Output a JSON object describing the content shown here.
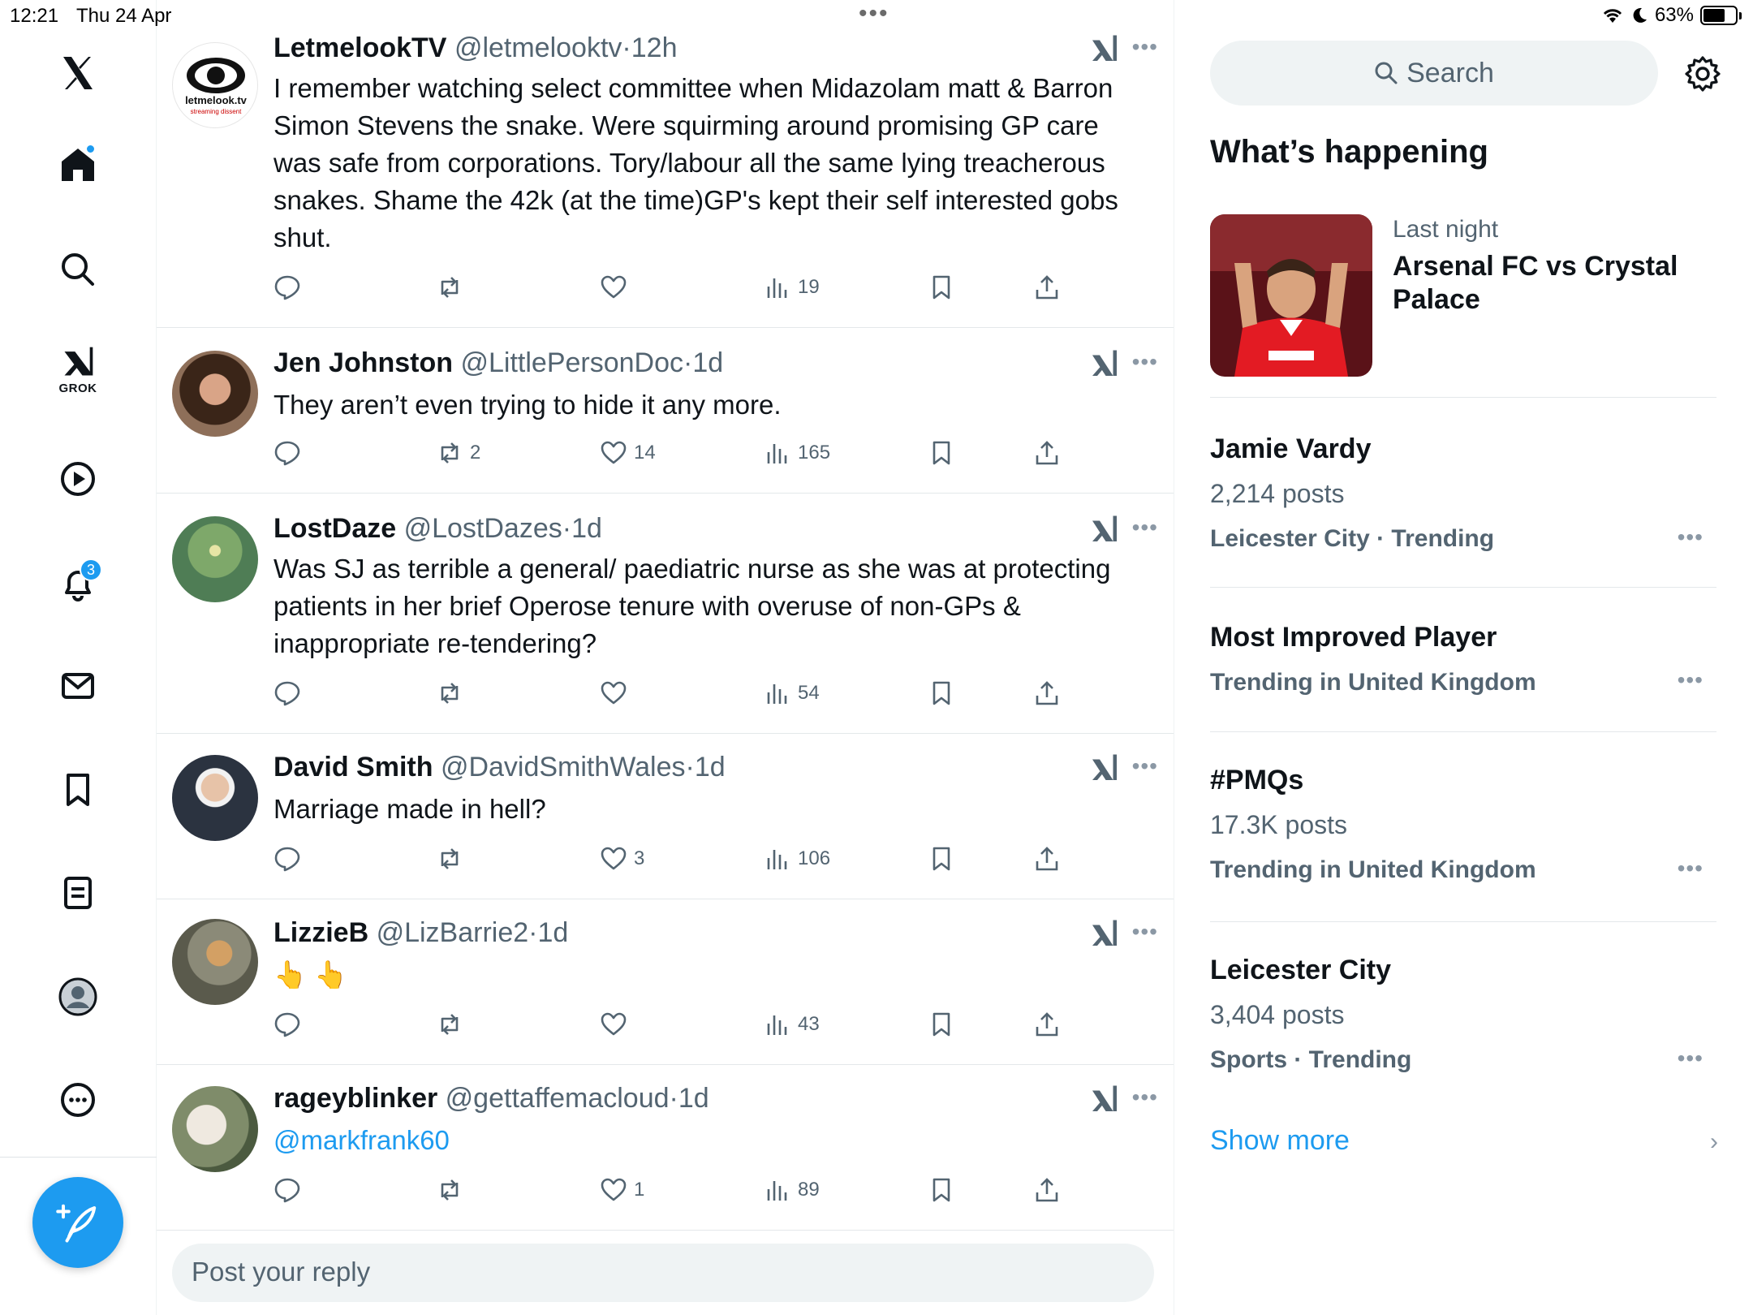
{
  "status_bar": {
    "time": "12:21",
    "date": "Thu 24 Apr",
    "battery": "63%",
    "dots": "•••"
  },
  "nav": {
    "grok_label": "GROK",
    "notifications_badge": "3",
    "accent": "#1d9bf0"
  },
  "tweets": [
    {
      "name": "LetmelookTV",
      "handle": "@letmelooktv",
      "time": "12h",
      "text": "I remember watching select committee when Midazolam matt & Barron Simon Stevens  the snake. Were squirming around promising GP care was safe from corporations. Tory/labour all the same lying treacherous snakes. Shame the 42k (at the time)GP's kept their self interested gobs shut.",
      "replies": "",
      "reposts": "",
      "likes": "",
      "views": "19",
      "avatar_text": "letmelook.tv",
      "avatar_sub": "streaming dissent"
    },
    {
      "name": "Jen Johnston",
      "handle": "@LittlePersonDoc",
      "time": "1d",
      "text": "They aren’t even trying to hide it any more.",
      "replies": "",
      "reposts": "2",
      "likes": "14",
      "views": "165"
    },
    {
      "name": "LostDaze",
      "handle": "@LostDazes",
      "time": "1d",
      "text": "Was SJ as terrible a general/ paediatric nurse as she was at protecting patients in her brief Operose tenure with overuse of non-GPs & inappropriate re-tendering?",
      "replies": "",
      "reposts": "",
      "likes": "",
      "views": "54"
    },
    {
      "name": "David Smith",
      "handle": "@DavidSmithWales",
      "time": "1d",
      "text": "Marriage made in hell?",
      "replies": "",
      "reposts": "",
      "likes": "3",
      "views": "106"
    },
    {
      "name": "LizzieB",
      "handle": "@LizBarrie2",
      "time": "1d",
      "text": "👆 👆",
      "replies": "",
      "reposts": "",
      "likes": "",
      "views": "43"
    },
    {
      "name": "rageyblinker",
      "handle": "@gettaffemacloud",
      "time": "1d",
      "text": "@markfrank60",
      "replies": "",
      "reposts": "",
      "likes": "1",
      "views": "89"
    }
  ],
  "reply": {
    "placeholder": "Post your reply"
  },
  "sidebar": {
    "search_label": "Search",
    "whats_happening": "What’s happening",
    "feature": {
      "meta": "Last night",
      "title": "Arsenal FC vs Crystal Palace"
    },
    "trends": [
      {
        "title": "Jamie Vardy",
        "posts": "2,214 posts",
        "context": "Leicester City · Trending"
      },
      {
        "title": "Most Improved Player",
        "posts": "",
        "context": "Trending in United Kingdom"
      },
      {
        "title": "#PMQs",
        "posts": "17.3K posts",
        "context": "Trending in United Kingdom"
      },
      {
        "title": "Leicester City",
        "posts": "3,404 posts",
        "context": "Sports · Trending"
      }
    ],
    "show_more": "Show more"
  }
}
